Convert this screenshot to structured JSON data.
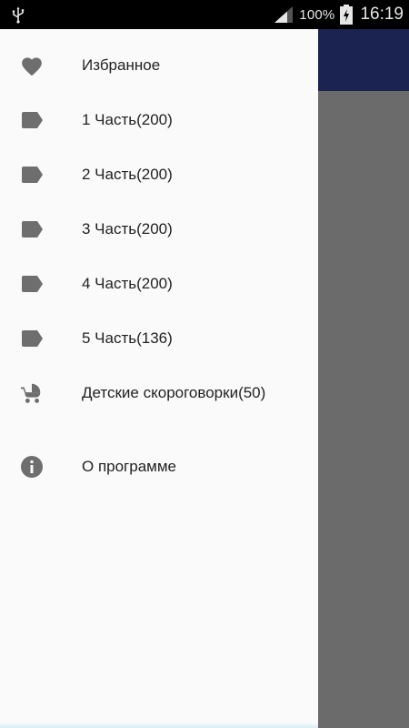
{
  "status_bar": {
    "battery_percent": "100%",
    "time": "16:19",
    "icons": [
      "usb-icon",
      "signal-icon",
      "battery-charging-icon"
    ]
  },
  "colors": {
    "app_bar": "#1b2350",
    "scrim": "#6b6b6b",
    "drawer_bg": "#fafafa",
    "icon": "#6e6e6e"
  },
  "menu": {
    "items": [
      {
        "label": "Избранное",
        "icon": "heart-icon"
      },
      {
        "label": "1 Часть(200)",
        "icon": "label-tag-icon"
      },
      {
        "label": "2 Часть(200)",
        "icon": "label-tag-icon"
      },
      {
        "label": "3 Часть(200)",
        "icon": "label-tag-icon"
      },
      {
        "label": "4 Часть(200)",
        "icon": "label-tag-icon"
      },
      {
        "label": "5 Часть(136)",
        "icon": "label-tag-icon"
      },
      {
        "label": "Детские скороговорки(50)",
        "icon": "stroller-icon"
      }
    ],
    "about": {
      "label": "О программе",
      "icon": "info-icon"
    }
  }
}
